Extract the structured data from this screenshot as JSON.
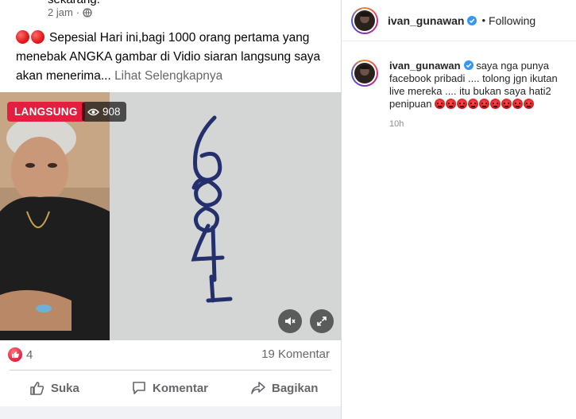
{
  "fb_post": {
    "clipped_text": "sekarang.",
    "timestamp": "2 jam",
    "post_text_prefix": "Sepesial Hari ini,bagi 1000 orang pertama yang menebak ANGKA gambar di Vidio siaran langsung saya akan menerima...",
    "see_more": "Lihat Selengkapnya",
    "video": {
      "live_label": "LANGSUNG",
      "viewer_count": "908",
      "board_numbers": "684"
    },
    "reaction_count": "4",
    "comment_count": "19 Komentar",
    "actions": {
      "like": "Suka",
      "comment": "Komentar",
      "share": "Bagikan"
    }
  },
  "ig_panel": {
    "header": {
      "username": "ivan_gunawan",
      "follow_status": "Following"
    },
    "comment": {
      "username": "ivan_gunawan",
      "text": "saya nga punya facebook pribadi .... tolong jgn ikutan live mereka .... itu bukan saya hati2 penipuan",
      "angry_emoji_count": 9,
      "time": "10h"
    }
  },
  "colors": {
    "live_red": "#e41e3f",
    "verified_blue": "#3897f0",
    "fb_gray_text": "#65676b"
  }
}
